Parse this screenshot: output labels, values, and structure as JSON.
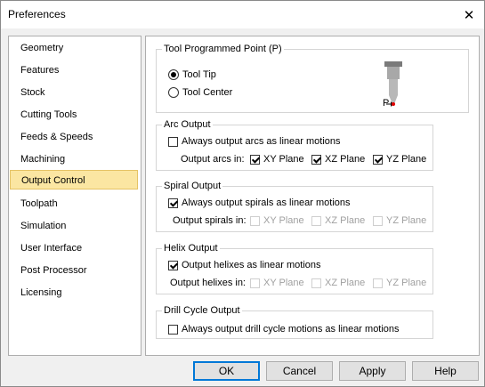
{
  "window": {
    "title": "Preferences"
  },
  "sidebar": {
    "items": [
      {
        "label": "Geometry"
      },
      {
        "label": "Features"
      },
      {
        "label": "Stock"
      },
      {
        "label": "Cutting Tools"
      },
      {
        "label": "Feeds & Speeds"
      },
      {
        "label": "Machining"
      },
      {
        "label": "Output Control"
      },
      {
        "label": "Toolpath"
      },
      {
        "label": "Simulation"
      },
      {
        "label": "User Interface"
      },
      {
        "label": "Post Processor"
      },
      {
        "label": "Licensing"
      }
    ],
    "selected": "Output Control"
  },
  "tool_point": {
    "label": "Tool Programmed Point (P)",
    "options": [
      "Tool Tip",
      "Tool Center"
    ],
    "selected": "Tool Tip",
    "icon_label": "P"
  },
  "arc": {
    "label": "Arc Output",
    "linear_label": "Always output arcs as linear motions",
    "linear_checked": false,
    "planes_label": "Output arcs in:",
    "planes": [
      {
        "label": "XY Plane",
        "checked": true
      },
      {
        "label": "XZ Plane",
        "checked": true
      },
      {
        "label": "YZ Plane",
        "checked": true
      }
    ]
  },
  "spiral": {
    "label": "Spiral Output",
    "linear_label": "Always output spirals as linear motions",
    "linear_checked": true,
    "planes_label": "Output spirals in:",
    "planes": [
      {
        "label": "XY Plane",
        "checked": false
      },
      {
        "label": "XZ Plane",
        "checked": false
      },
      {
        "label": "YZ Plane",
        "checked": false
      }
    ]
  },
  "helix": {
    "label": "Helix Output",
    "linear_label": "Output helixes as linear motions",
    "linear_checked": true,
    "planes_label": "Output helixes in:",
    "planes": [
      {
        "label": "XY Plane",
        "checked": false
      },
      {
        "label": "XZ Plane",
        "checked": false
      },
      {
        "label": "YZ Plane",
        "checked": false
      }
    ]
  },
  "drill": {
    "label": "Drill Cycle Output",
    "linear_label": "Always output drill cycle motions as linear motions",
    "linear_checked": false
  },
  "buttons": {
    "ok": "OK",
    "cancel": "Cancel",
    "apply": "Apply",
    "help": "Help"
  },
  "colors": {
    "selection_bg": "#fbe6a2",
    "default_button_border": "#0078d7",
    "tool_tip_marker": "#e00000"
  }
}
